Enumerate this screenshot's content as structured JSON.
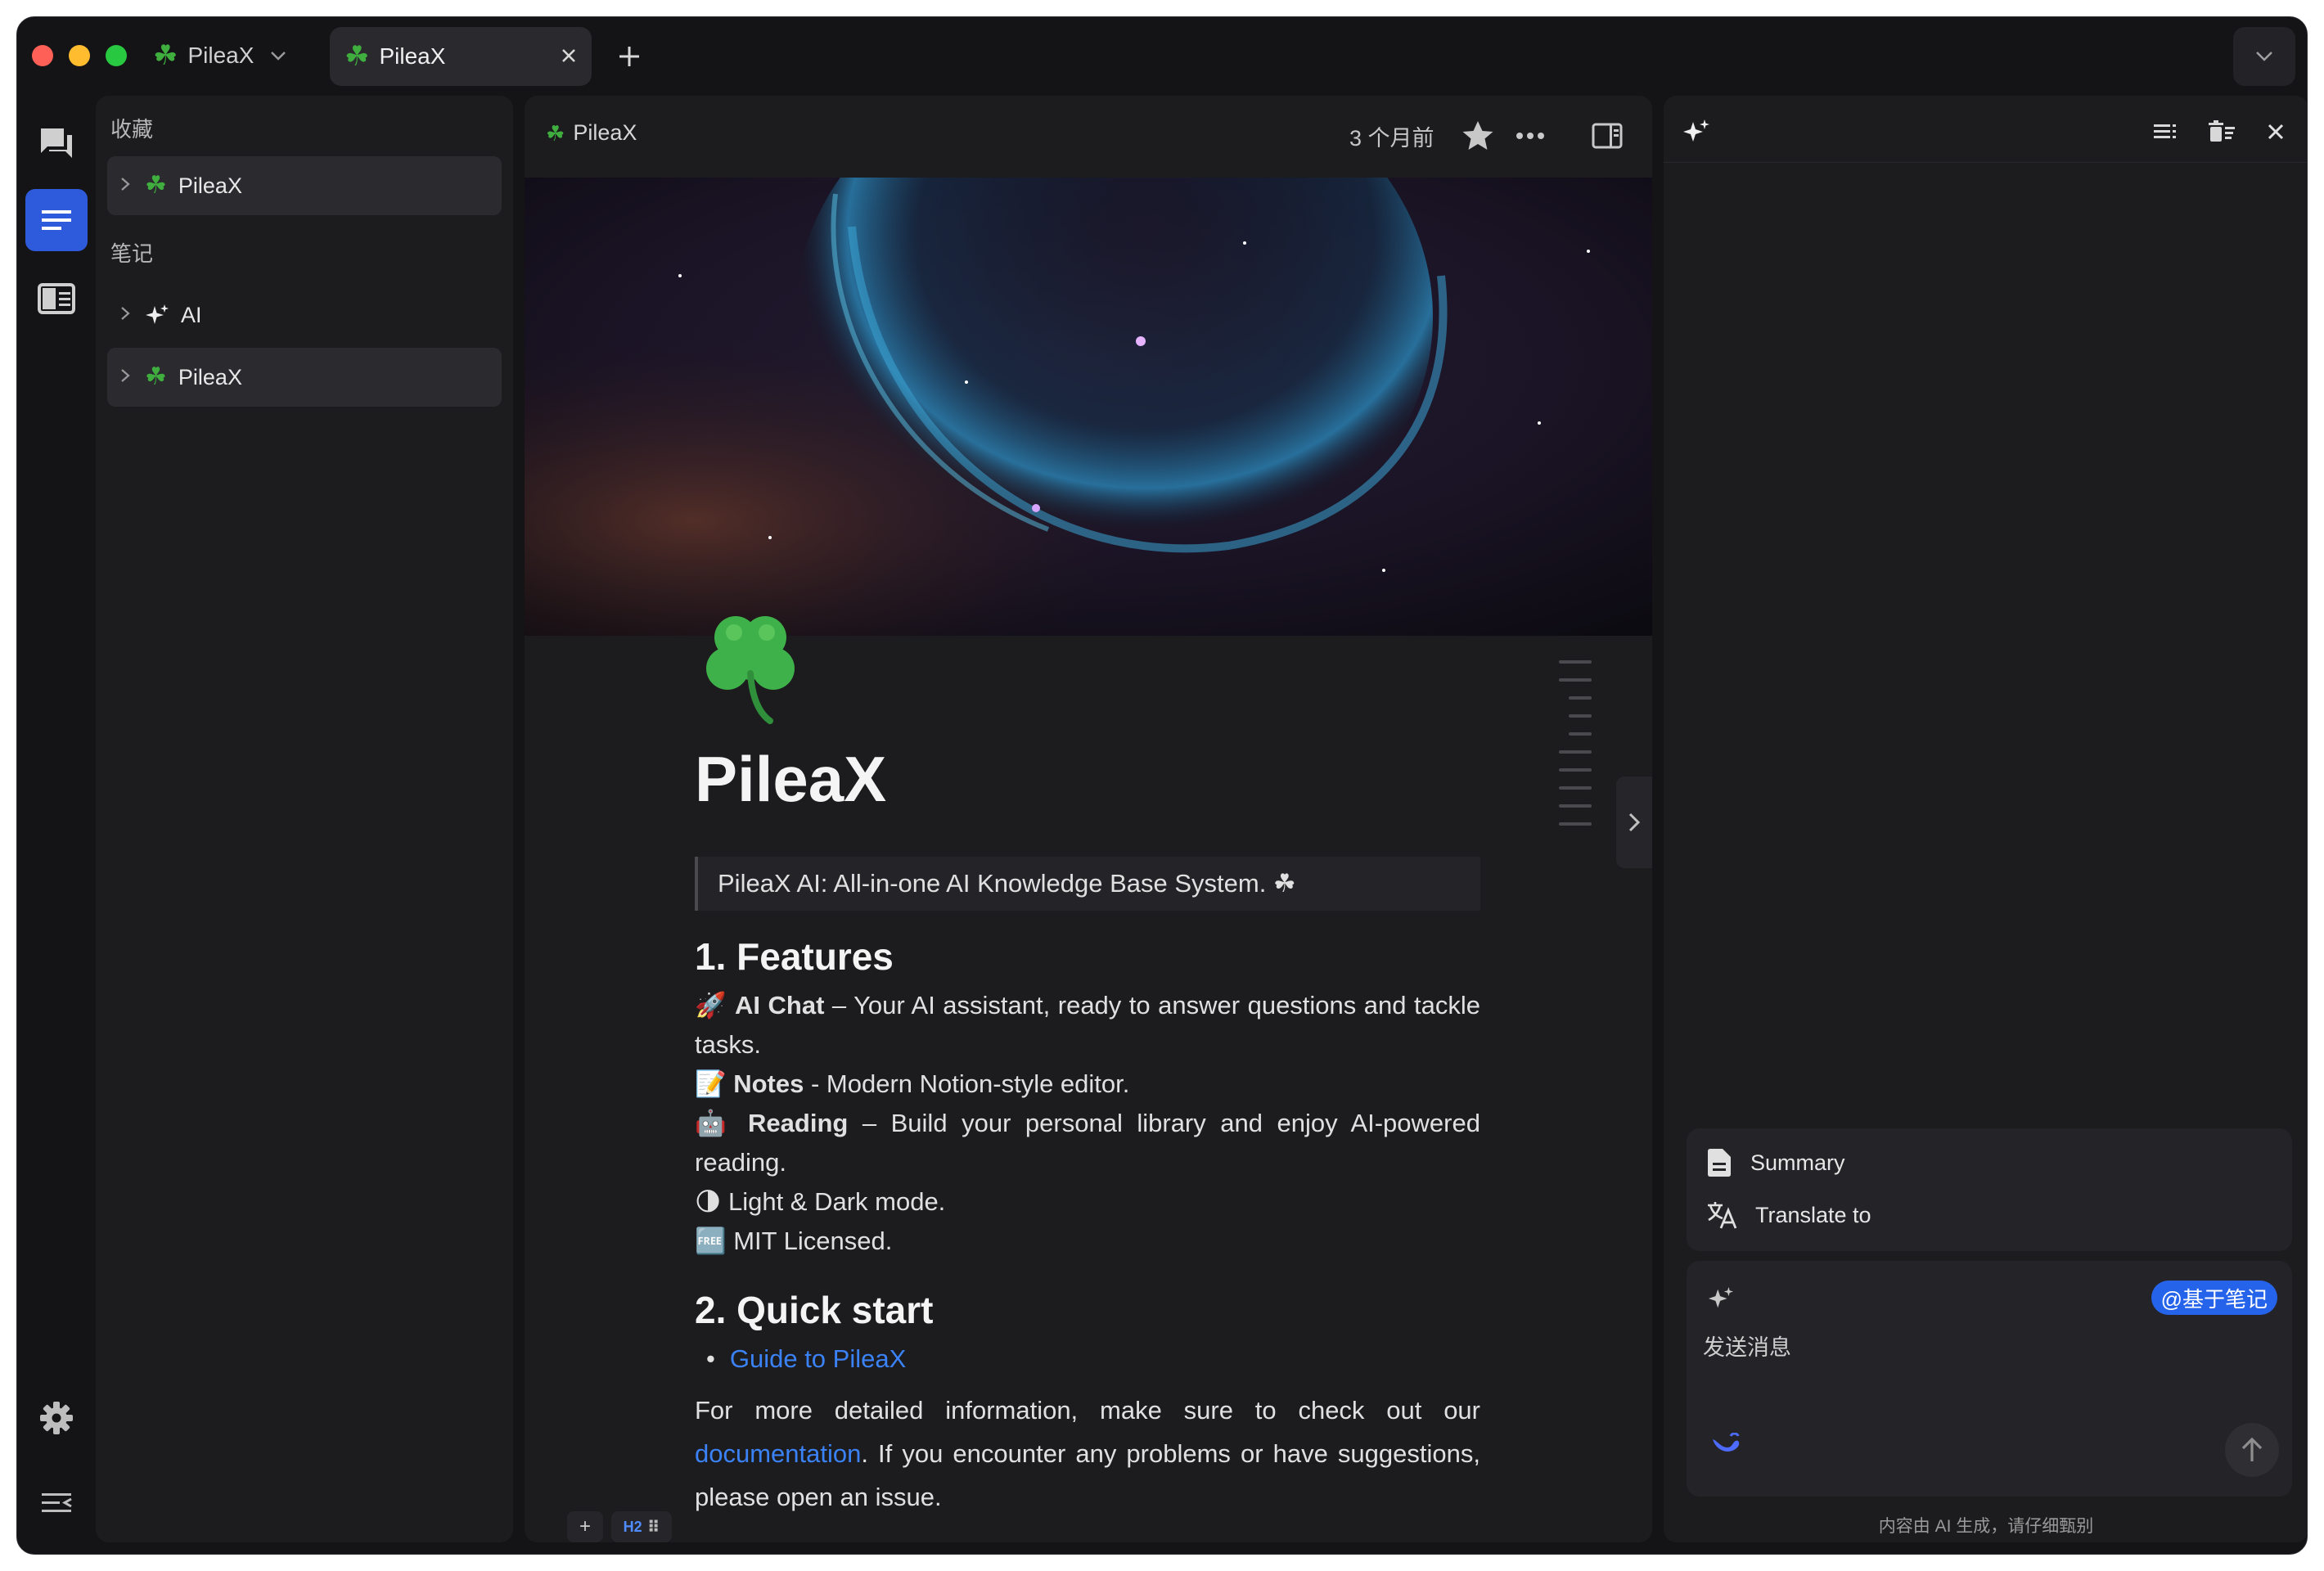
{
  "titlebar": {
    "workspace": "PileaX",
    "tab_title": "PileaX",
    "icons": [
      "clover-icon",
      "chevron-down-icon",
      "close-icon",
      "plus-icon"
    ]
  },
  "rail": {
    "icons": [
      "chat-icon",
      "notes-icon",
      "reader-icon",
      "gear-icon",
      "collapse-icon"
    ],
    "accent": "#2e5bdc"
  },
  "sidebar": {
    "favorites_title": "收藏",
    "favorites": [
      {
        "label": "PileaX",
        "icon": "clover-icon"
      }
    ],
    "notes_title": "笔记",
    "notes": [
      {
        "label": "AI",
        "icon": "sparkle-icon"
      },
      {
        "label": "PileaX",
        "icon": "clover-icon"
      }
    ]
  },
  "editor": {
    "breadcrumb": "PileaX",
    "updated": "3 个月前",
    "title": "PileaX",
    "quote": "PileaX AI: All-in-one AI Knowledge Base System. ☘",
    "h_features": "1. Features",
    "f1_bold": "AI Chat",
    "f1_text": " – Your AI assistant, ready to answer questions and tackle tasks.",
    "f2_bold": "Notes",
    "f2_text": " - Modern Notion-style editor.",
    "f3_bold": "Reading",
    "f3_text": " – Build your personal library and enjoy AI-powered reading.",
    "f4_text": "Light & Dark mode.",
    "f5_text": "MIT Licensed.",
    "h_quick": "2. Quick start",
    "guide_link": "Guide to PileaX",
    "p_before": "For more detailed information, make sure to check out our ",
    "p_link": "documentation",
    "p_after": ". If you encounter any problems or have suggestions, please open an issue.",
    "block_add": "+",
    "block_type": "H2"
  },
  "ai_panel": {
    "quick_actions": [
      {
        "label": "Summary",
        "icon": "document-icon"
      },
      {
        "label": "Translate to",
        "icon": "translate-icon"
      }
    ],
    "chip": "@基于笔记",
    "placeholder": "发送消息",
    "disclaimer": "内容由 AI 生成，请仔细甄别",
    "accent": "#2563eb"
  }
}
